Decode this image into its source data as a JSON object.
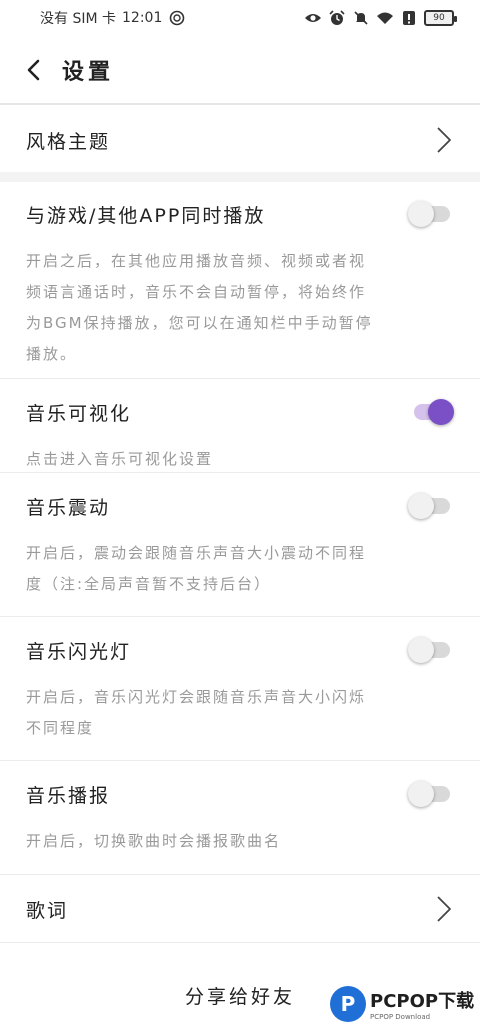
{
  "status_bar": {
    "carrier": "没有 SIM 卡",
    "time": "12:01",
    "battery": "90",
    "icons": [
      "sync-icon",
      "eye-icon",
      "alarm-icon",
      "mute-icon",
      "wifi-icon",
      "alert-icon",
      "battery-icon"
    ]
  },
  "header": {
    "title": "设置",
    "back_icon": "chevron-left-icon"
  },
  "theme_row": {
    "label": "风格主题",
    "icon": "chevron-right-icon"
  },
  "settings": [
    {
      "id": "play-with-games",
      "label": "与游戏/其他APP同时播放",
      "enabled": false,
      "description": "开启之后，在其他应用播放音频、视频或者视频语言通话时，音乐不会自动暂停，将始终作为BGM保持播放，您可以在通知栏中手动暂停播放。",
      "desc_lines": [
        "开启之后，在其他应用播放音频、视频或者视",
        "频语言通话时，音乐不会自动暂停，将始终作",
        "为BGM保持播放，您可以在通知栏中手动暂停",
        "播放。"
      ]
    },
    {
      "id": "music-visualization",
      "label": "音乐可视化",
      "enabled": true,
      "description": "点击进入音乐可视化设置",
      "desc_lines": [
        "点击进入音乐可视化设置"
      ]
    },
    {
      "id": "music-vibration",
      "label": "音乐震动",
      "enabled": false,
      "description": "开启后，震动会跟随音乐声音大小震动不同程度（注:全局声音暂不支持后台）",
      "desc_lines": [
        "开启后，震动会跟随音乐声音大小震动不同程",
        "度（注:全局声音暂不支持后台）"
      ]
    },
    {
      "id": "music-flash",
      "label": "音乐闪光灯",
      "enabled": false,
      "description": "开启后，音乐闪光灯会跟随音乐声音大小闪烁不同程度",
      "desc_lines": [
        "开启后，音乐闪光灯会跟随音乐声音大小闪烁",
        "不同程度"
      ]
    },
    {
      "id": "music-broadcast",
      "label": "音乐播报",
      "enabled": false,
      "description": "开启后，切换歌曲时会播报歌曲名",
      "desc_lines": [
        "开启后，切换歌曲时会播报歌曲名"
      ]
    }
  ],
  "lyrics_row": {
    "label": "歌词",
    "icon": "chevron-right-icon"
  },
  "share": {
    "label": "分享给好友"
  },
  "watermark": {
    "logo_letter": "P",
    "title": "PCPOP下载",
    "subtitle": "PCPOP Download"
  },
  "colors": {
    "accent": "#7b4fc6",
    "accent_track": "#d4c2ec",
    "desc_text": "#9a9a9a",
    "band": "#f3f3f3"
  }
}
